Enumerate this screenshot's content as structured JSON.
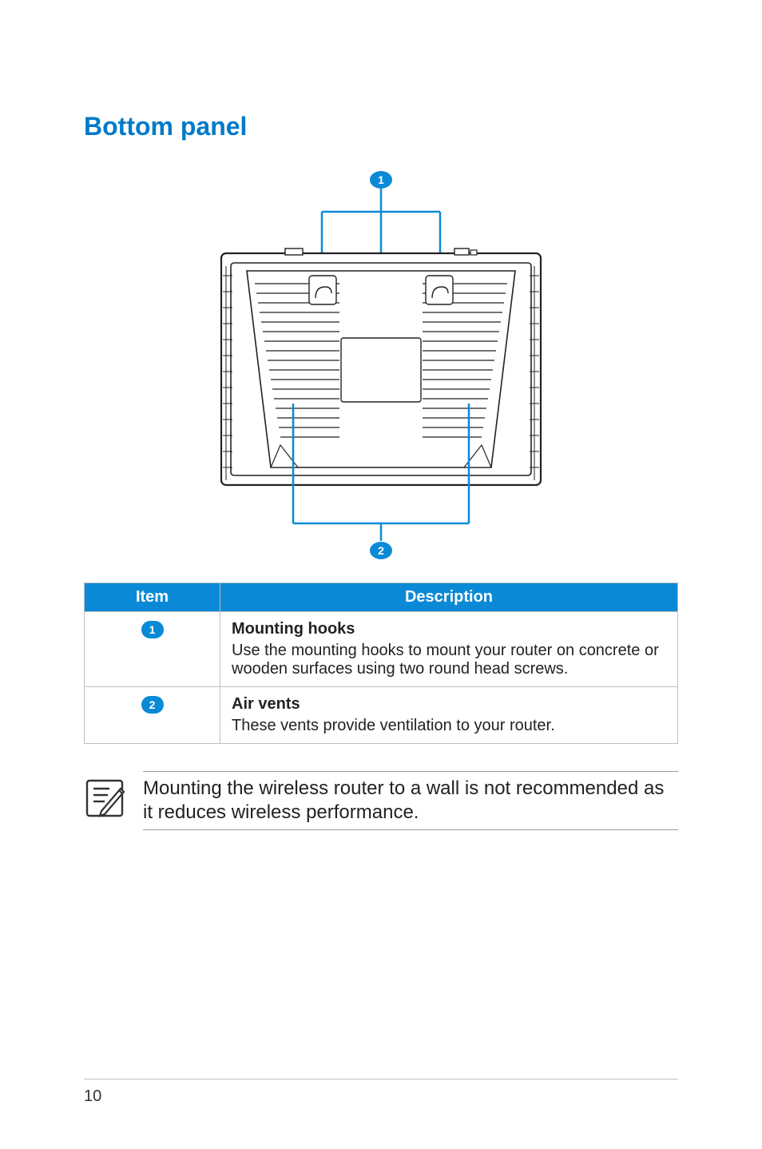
{
  "section_title": "Bottom panel",
  "callouts": {
    "top": "1",
    "bottom": "2"
  },
  "table": {
    "headers": {
      "item": "Item",
      "description": "Description"
    },
    "rows": [
      {
        "badge": "1",
        "title": "Mounting hooks",
        "body": "Use the mounting hooks to mount your router on concrete or wooden surfaces using two round head screws."
      },
      {
        "badge": "2",
        "title": "Air vents",
        "body": "These vents provide ventilation to your router."
      }
    ]
  },
  "note": "Mounting the wireless router to a wall is not recommended as it reduces wireless performance.",
  "page_number": "10",
  "colors": {
    "accent": "#0a8ad6",
    "title": "#007ac8"
  }
}
